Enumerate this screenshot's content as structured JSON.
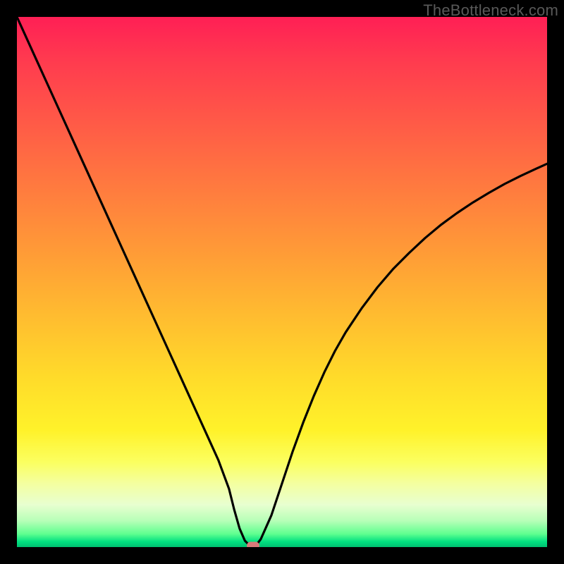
{
  "watermark": "TheBottleneck.com",
  "colors": {
    "frame": "#000000",
    "curve_stroke": "#000000",
    "marker": "#d97a7a",
    "gradient_top": "#ff1f55",
    "gradient_mid": "#ffdb2a",
    "gradient_bottom": "#00c070"
  },
  "chart_data": {
    "type": "line",
    "title": "",
    "xlabel": "",
    "ylabel": "",
    "xlim": [
      0,
      100
    ],
    "ylim": [
      0,
      100
    ],
    "x": [
      0,
      2,
      4,
      6,
      8,
      10,
      12,
      14,
      16,
      18,
      20,
      22,
      24,
      26,
      28,
      30,
      32,
      34,
      36,
      38,
      40,
      41,
      42,
      43,
      44,
      45,
      46,
      48,
      50,
      52,
      54,
      56,
      58,
      60,
      62,
      65,
      68,
      71,
      74,
      77,
      80,
      83,
      86,
      89,
      92,
      95,
      98,
      100
    ],
    "values": [
      100,
      95.6,
      91.2,
      86.8,
      82.4,
      78,
      73.6,
      69.2,
      64.8,
      60.4,
      56,
      51.6,
      47.2,
      42.8,
      38.4,
      34,
      29.6,
      25.2,
      20.8,
      16.4,
      11,
      7,
      3.5,
      1.2,
      0.2,
      0.2,
      1.5,
      6,
      12,
      18,
      23.5,
      28.5,
      33,
      37,
      40.5,
      45,
      49,
      52.5,
      55.5,
      58.3,
      60.8,
      63,
      65,
      66.8,
      68.5,
      70,
      71.4,
      72.3
    ],
    "grid": false,
    "legend": false,
    "marker": {
      "x": 44.5,
      "y": 0.2
    }
  }
}
